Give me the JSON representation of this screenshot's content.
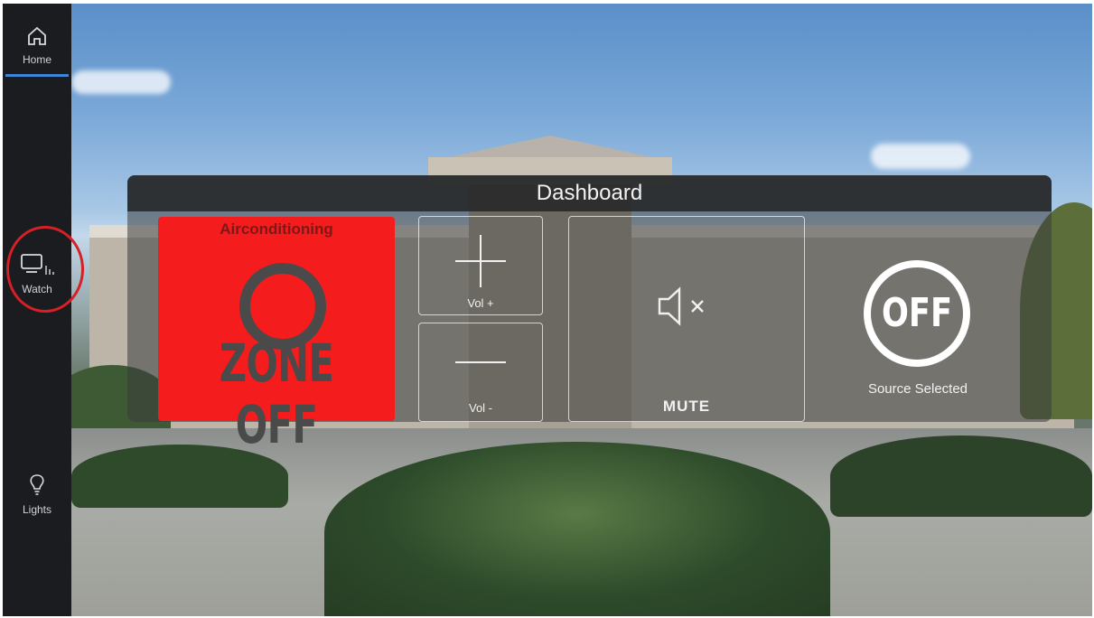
{
  "sidebar": {
    "items": [
      {
        "label": "Home",
        "icon": "home-icon",
        "active": true
      },
      {
        "label": "Watch",
        "icon": "tv-icon",
        "highlighted": true
      },
      {
        "label": "Lights",
        "icon": "lightbulb-icon"
      }
    ]
  },
  "dashboard": {
    "title": "Dashboard",
    "aircon": {
      "title": "Airconditioning",
      "status": "ZONE OFF",
      "color": "#f41c1c"
    },
    "vol_up": {
      "label": "Vol +"
    },
    "vol_down": {
      "label": "Vol -"
    },
    "mute": {
      "label": "MUTE"
    },
    "source": {
      "value": "OFF",
      "label": "Source Selected"
    }
  },
  "colors": {
    "accent": "#3d86d8",
    "highlight_ring": "#d42026"
  }
}
